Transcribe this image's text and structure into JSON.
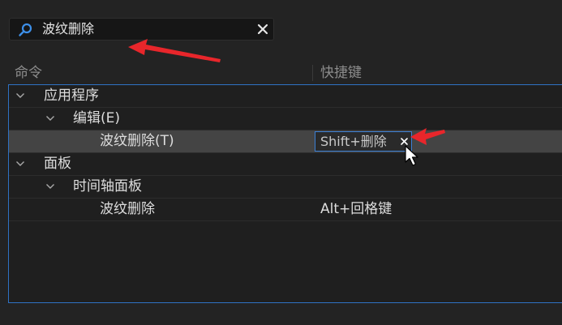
{
  "search": {
    "value": "波纹删除",
    "icon": "search-icon",
    "clear_icon": "close-icon"
  },
  "columns": {
    "command": "命令",
    "shortcut": "快捷键"
  },
  "tree": {
    "rows": [
      {
        "label": "应用程序",
        "level": 0,
        "expanded": true,
        "shortcut": ""
      },
      {
        "label": "编辑(E)",
        "level": 1,
        "expanded": true,
        "shortcut": ""
      },
      {
        "label": "波纹删除(T)",
        "level": 2,
        "selected": true,
        "shortcut": "Shift+删除"
      },
      {
        "label": "面板",
        "level": 0,
        "expanded": true,
        "shortcut": ""
      },
      {
        "label": "时间轴面板",
        "level": 1,
        "expanded": true,
        "shortcut": ""
      },
      {
        "label": "波纹删除",
        "level": 2,
        "shortcut": "Alt+回格键"
      }
    ]
  },
  "colors": {
    "background": "#232323",
    "selection": "#444444",
    "focus_border": "#2f72c4",
    "annotation_arrow": "#e8262b"
  }
}
